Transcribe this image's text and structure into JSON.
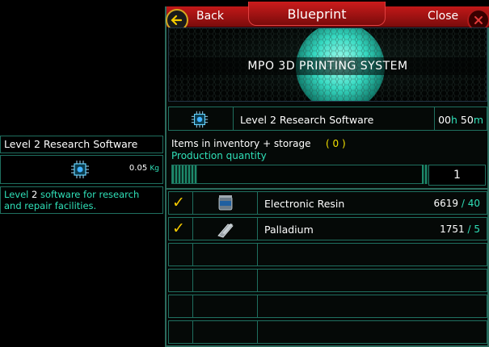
{
  "header": {
    "back_label": "Back",
    "title": "Blueprint",
    "close_label": "Close"
  },
  "banner": {
    "title": "MPO 3D PRINTING SYSTEM"
  },
  "item": {
    "name": "Level 2 Research Software",
    "time_hours": "00",
    "time_hours_unit": "h",
    "time_minutes": "50",
    "time_minutes_unit": "m",
    "icon": "chip-icon"
  },
  "inventory": {
    "label": "Items in inventory + storage",
    "count": "( 0 )",
    "production_label": "Production quantity",
    "quantity": "1"
  },
  "materials": [
    {
      "name": "Electronic Resin",
      "have": "6619",
      "sep": " / ",
      "need": "40",
      "checked": true,
      "icon": "resin-canister-icon"
    },
    {
      "name": "Palladium",
      "have": "1751",
      "sep": " / ",
      "need": "5",
      "checked": true,
      "icon": "metal-bar-icon"
    }
  ],
  "tooltip": {
    "title": "Level 2 Research Software",
    "weight": "0.05",
    "weight_unit": "Kg",
    "desc_a": "Level",
    "desc_b": " 2 ",
    "desc_c": "software for research and repair facilities."
  },
  "check_glyph": "✓",
  "colors": {
    "accent": "#2fe0b8",
    "header_red": "#c21818",
    "check_yellow": "#f3c800",
    "border": "#1f6f5f"
  }
}
